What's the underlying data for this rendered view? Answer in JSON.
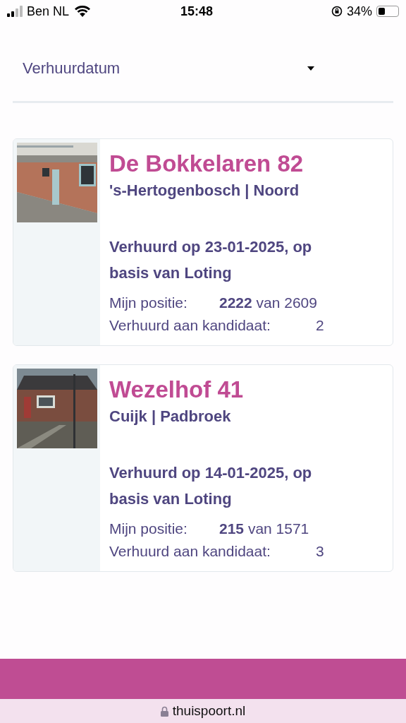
{
  "status_bar": {
    "carrier": "Ben NL",
    "time": "15:48",
    "battery": "34%"
  },
  "sort": {
    "value": "Verhuurdatum"
  },
  "listings": [
    {
      "title": "De Bokkelaren 82",
      "location": "'s-Hertogenbosch | Noord",
      "rented": "Verhuurd op 23-01-2025, op basis van Loting",
      "position_label": "Mijn positie:",
      "position": "**2222** van 2609",
      "candidate_label": "Verhuurd aan kandidaat:",
      "candidate": "2"
    },
    {
      "title": "Wezelhof 41",
      "location": "Cuijk | Padbroek",
      "rented": "Verhuurd op 14-01-2025, op basis van Loting",
      "position_label": "Mijn positie:",
      "position": "**215** van 1571",
      "candidate_label": "Verhuurd aan kandidaat:",
      "candidate": "3"
    }
  ],
  "browser_bar": {
    "url": "thuispoort.nl"
  }
}
